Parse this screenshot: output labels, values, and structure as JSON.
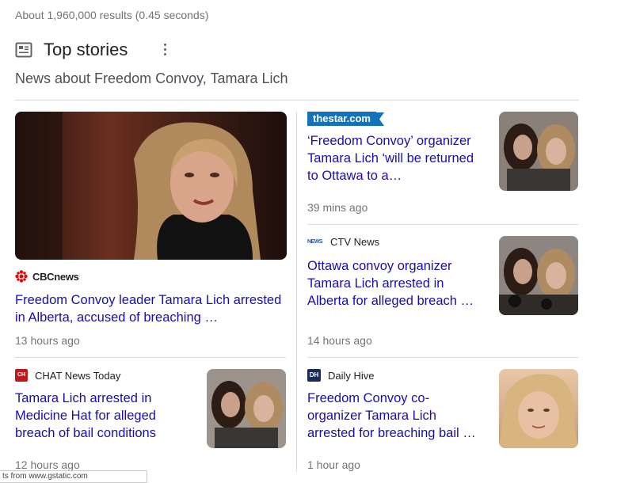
{
  "result_stats": "About 1,960,000 results (0.45 seconds)",
  "top_stories": {
    "title": "Top stories",
    "subtitle": "News about Freedom Convoy, Tamara Lich"
  },
  "stories": [
    {
      "source": "CBCnews",
      "headline": "Freedom Convoy leader Tamara Lich arrested in Alberta, accused of breaching …",
      "time": "13 hours ago"
    },
    {
      "source": "thestar.com",
      "headline": "‘Freedom Convoy’ organizer Tamara Lich ‘will be returned to Ottawa to a…",
      "time": "39 mins ago"
    },
    {
      "source": "CTV News",
      "headline": "Ottawa convoy organizer Tamara Lich arrested in Alberta for alleged breach …",
      "time": "14 hours ago"
    },
    {
      "source": "CHAT News Today",
      "headline": "Tamara Lich arrested in Medicine Hat for alleged breach of bail conditions",
      "time": "12 hours ago"
    },
    {
      "source": "Daily Hive",
      "headline": "Freedom Convoy co-organizer Tamara Lich arrested for breaching bail …",
      "time": "1 hour ago"
    }
  ],
  "status_bar": "ts from www.gstatic.com",
  "colors": {
    "link": "#1a0dab",
    "meta": "#70757a",
    "star_blue": "#1473b8",
    "cbc_red": "#e60505"
  }
}
